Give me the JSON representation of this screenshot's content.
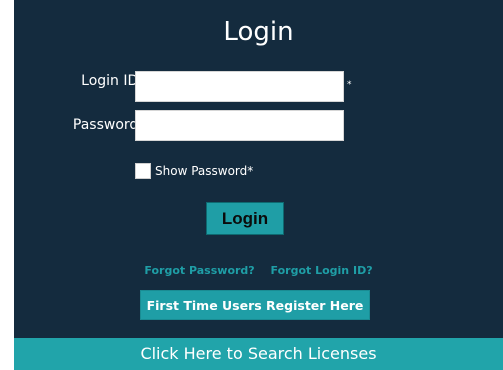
{
  "login_form": {
    "title": "Login",
    "login_id_label": "Login ID:",
    "login_id_value": "",
    "required_marker": "*",
    "password_label": "Password:",
    "password_value": "",
    "show_password_label": "Show Password*",
    "show_password_checked": false,
    "login_button_label": "Login"
  },
  "links": {
    "forgot_password": "Forgot Password?",
    "forgot_login_id": "Forgot Login ID?"
  },
  "register_button_label": "First Time Users Register Here",
  "search_licenses_label": "Click Here to Search Licenses",
  "colors": {
    "panel_background": "#142b3e",
    "accent": "#1f9ea6",
    "search_bar": "#21a4aa"
  }
}
